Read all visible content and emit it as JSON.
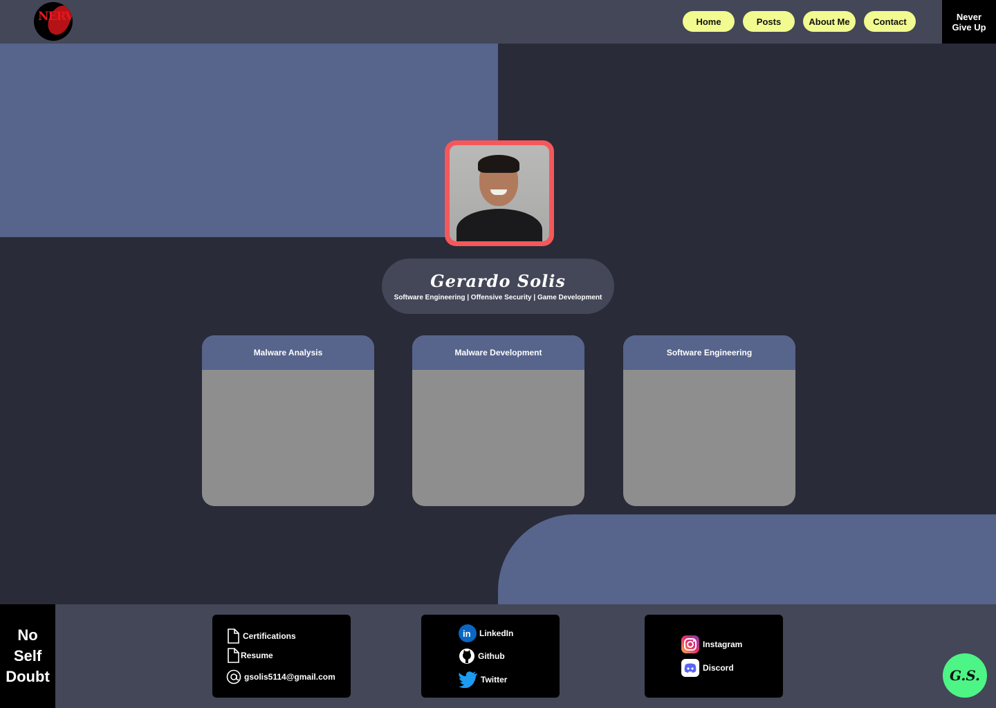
{
  "header": {
    "logo_text": "NERV",
    "nav": [
      "Home",
      "Posts",
      "About Me",
      "Contact"
    ],
    "motto": "Never Give Up"
  },
  "profile": {
    "name": "Gerardo Solis",
    "tagline": "Software Engineering | Offensive Security | Game Development"
  },
  "cards": [
    {
      "title": "Malware Analysis"
    },
    {
      "title": "Malware Development"
    },
    {
      "title": "Software Engineering"
    }
  ],
  "footer": {
    "motto": "No Self Doubt",
    "documents": {
      "certifications": "Certifications",
      "resume": "Resume",
      "email": "gsolis5114@gmail.com"
    },
    "social_1": {
      "linkedin": "LinkedIn",
      "github": "Github",
      "twitter": "Twitter"
    },
    "social_2": {
      "instagram": "Instagram",
      "discord": "Discord"
    },
    "initials": "G.S."
  },
  "colors": {
    "header_bg": "#444758",
    "page_bg": "#292b38",
    "accent_blue": "#57648c",
    "nav_button": "#f1fb8f",
    "photo_border": "#f4585a",
    "initials_button": "#4cf585"
  }
}
